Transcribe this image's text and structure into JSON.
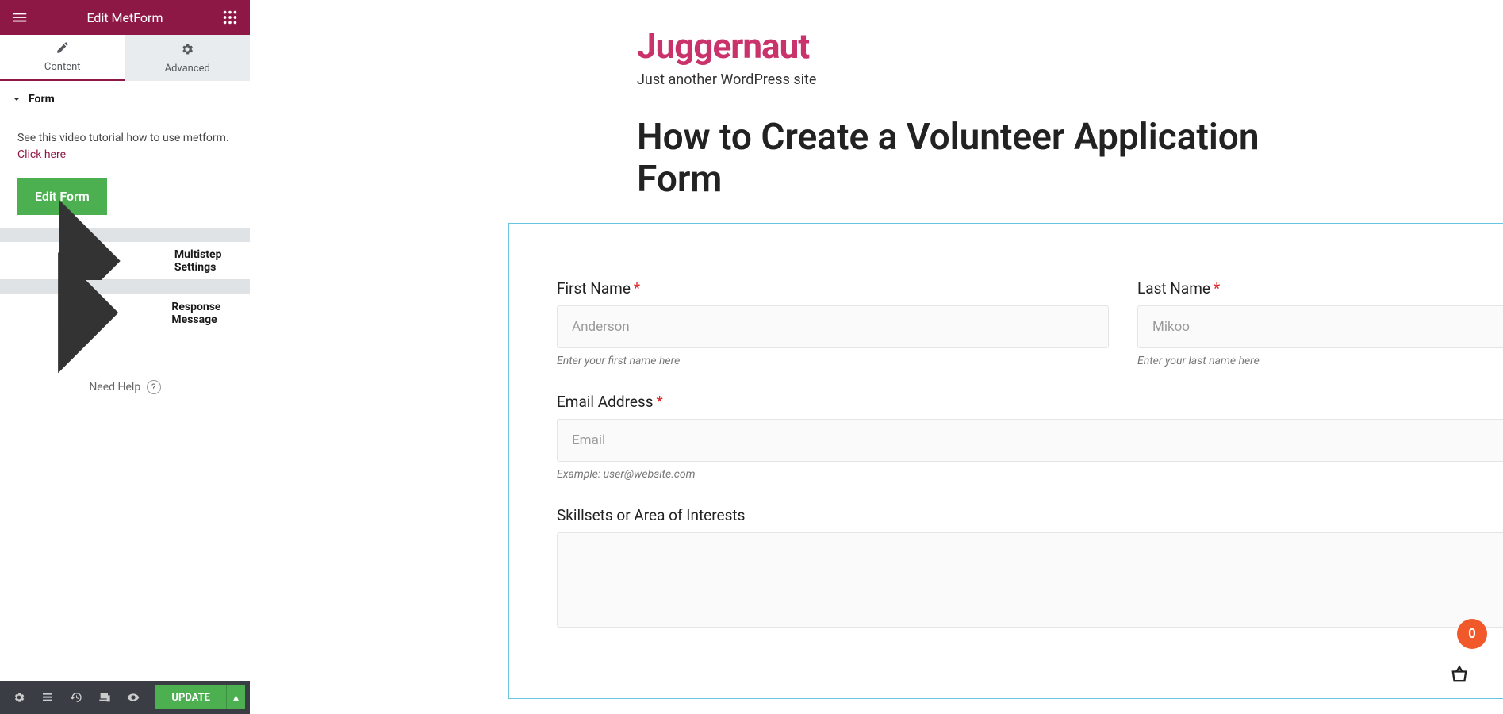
{
  "topbar": {
    "title": "Edit MetForm"
  },
  "tabs": {
    "content": "Content",
    "advanced": "Advanced"
  },
  "sections": {
    "form": {
      "title": "Form",
      "tutorial_prefix": "See this video tutorial how to use metform. ",
      "tutorial_link": "Click here",
      "edit_button": "Edit Form"
    },
    "multistep": {
      "title": "Multistep Settings"
    },
    "response": {
      "title": "Response Message"
    }
  },
  "need_help": "Need Help",
  "footer": {
    "update": "UPDATE"
  },
  "site": {
    "title": "Juggernaut",
    "tagline": "Just another WordPress site",
    "post_title": "How to Create a Volunteer Application Form"
  },
  "form_fields": {
    "first_name": {
      "label": "First Name",
      "placeholder": "Anderson",
      "help": "Enter your first name here"
    },
    "last_name": {
      "label": "Last Name",
      "placeholder": "Mikoo",
      "help": "Enter your last name here"
    },
    "email": {
      "label": "Email Address",
      "placeholder": "Email",
      "help": "Example: user@website.com"
    },
    "skillsets": {
      "label": "Skillsets or Area of Interests"
    }
  },
  "cart": {
    "count": "0"
  }
}
